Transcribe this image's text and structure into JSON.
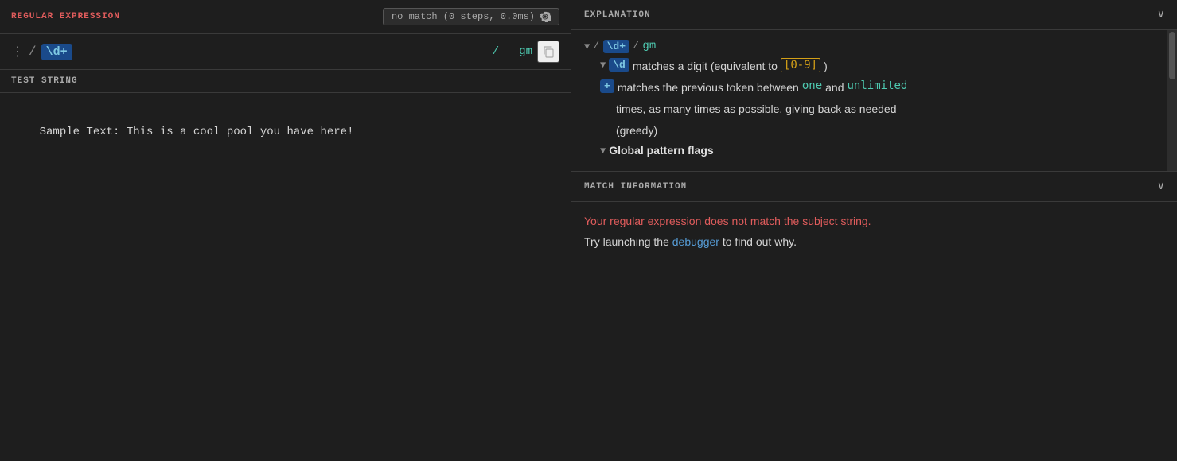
{
  "left": {
    "regex_title": "REGULAR EXPRESSION",
    "status_badge": "no match (0 steps, 0.0ms)",
    "dots": "⋮",
    "slash_open": "/",
    "regex_token": "\\d+",
    "slash_close": "/",
    "flags": "gm",
    "test_string_title": "TEST STRING",
    "test_string_content": "Sample Text: This is a cool pool you have here!"
  },
  "right": {
    "explanation_title": "EXPLANATION",
    "chevron": "∨",
    "exp_line1_slash": "/",
    "exp_line1_token": "\\d+",
    "exp_line1_slash2": "/",
    "exp_line1_flags": "gm",
    "exp_backslash_d": "\\d",
    "exp_backslash_d_text": "matches a digit (equivalent to",
    "exp_char_class": "[0-9]",
    "exp_closing_paren": ")",
    "exp_plus": "+",
    "exp_plus_text1": "matches the previous token between",
    "exp_plus_one": "one",
    "exp_plus_and": "and",
    "exp_plus_unlimited": "unlimited",
    "exp_plus_text2": "times, as many times as possible, giving back as needed",
    "exp_plus_text3": "(greedy)",
    "exp_global_flags": "Global pattern flags",
    "match_info_title": "MATCH INFORMATION",
    "match_chevron": "∨",
    "match_no_match": "Your regular expression does not match the subject string.",
    "match_debugger_prefix": "Try launching the",
    "match_debugger_link": "debugger",
    "match_debugger_suffix": "to find out why."
  }
}
